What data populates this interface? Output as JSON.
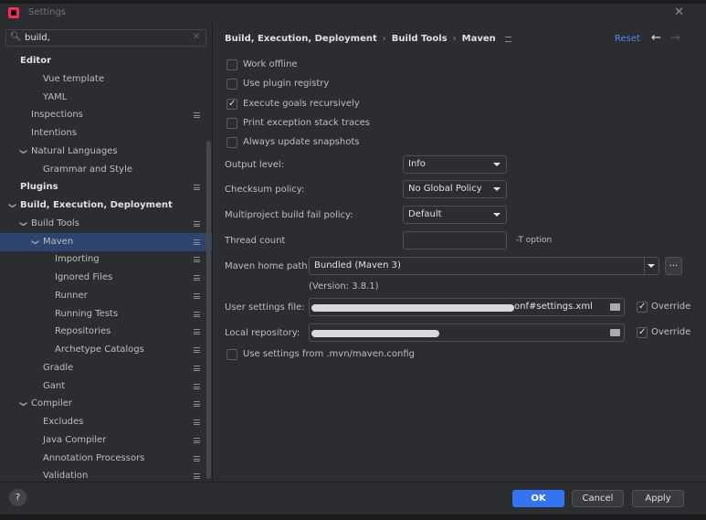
{
  "window": {
    "title": "Settings",
    "close_icon": "close-icon"
  },
  "colors": {
    "accent": "#3574f0",
    "selection": "#2e436e",
    "link": "#548af7",
    "background": "#2b2d30"
  },
  "search": {
    "value": "build,",
    "icon": "search-icon"
  },
  "tree": [
    {
      "label": "Editor",
      "bold": true,
      "level": 0,
      "chevron": "",
      "pg": false
    },
    {
      "label": "Vue template",
      "level": 2,
      "chevron": "",
      "pg": false
    },
    {
      "label": "YAML",
      "level": 2,
      "chevron": "",
      "pg": false
    },
    {
      "label": "Inspections",
      "level": 1,
      "chevron": "",
      "pg": true
    },
    {
      "label": "Intentions",
      "level": 1,
      "chevron": "",
      "pg": false
    },
    {
      "label": "Natural Languages",
      "level": 1,
      "chevron": "v",
      "pg": false
    },
    {
      "label": "Grammar and Style",
      "level": 2,
      "chevron": "",
      "pg": false
    },
    {
      "label": "Plugins",
      "bold": true,
      "level": 0,
      "chevron": "",
      "pg": true
    },
    {
      "label": "Build, Execution, Deployment",
      "bold": true,
      "level": 0,
      "chevron": "v",
      "pg": false
    },
    {
      "label": "Build Tools",
      "level": 1,
      "chevron": "v",
      "pg": true
    },
    {
      "label": "Maven",
      "level": 2,
      "chevron": "v",
      "pg": true,
      "selected": true
    },
    {
      "label": "Importing",
      "level": 3,
      "chevron": "",
      "pg": true
    },
    {
      "label": "Ignored Files",
      "level": 3,
      "chevron": "",
      "pg": true
    },
    {
      "label": "Runner",
      "level": 3,
      "chevron": "",
      "pg": true
    },
    {
      "label": "Running Tests",
      "level": 3,
      "chevron": "",
      "pg": true
    },
    {
      "label": "Repositories",
      "level": 3,
      "chevron": "",
      "pg": true
    },
    {
      "label": "Archetype Catalogs",
      "level": 3,
      "chevron": "",
      "pg": true
    },
    {
      "label": "Gradle",
      "level": 2,
      "chevron": "",
      "pg": true
    },
    {
      "label": "Gant",
      "level": 2,
      "chevron": "",
      "pg": true
    },
    {
      "label": "Compiler",
      "level": 1,
      "chevron": "v",
      "pg": true
    },
    {
      "label": "Excludes",
      "level": 2,
      "chevron": "",
      "pg": true
    },
    {
      "label": "Java Compiler",
      "level": 2,
      "chevron": "",
      "pg": true
    },
    {
      "label": "Annotation Processors",
      "level": 2,
      "chevron": "",
      "pg": true
    },
    {
      "label": "Validation",
      "level": 2,
      "chevron": "",
      "pg": true
    }
  ],
  "breadcrumb": {
    "items": [
      "Build, Execution, Deployment",
      "Build Tools",
      "Maven"
    ],
    "separator": "›"
  },
  "header": {
    "reset_label": "Reset",
    "back_icon": "←",
    "forward_icon": "→"
  },
  "options": [
    {
      "label": "Work offline",
      "checked": false
    },
    {
      "label": "Use plugin registry",
      "checked": false
    },
    {
      "label": "Execute goals recursively",
      "checked": true
    },
    {
      "label": "Print exception stack traces",
      "checked": false
    },
    {
      "label": "Always update snapshots",
      "checked": false
    }
  ],
  "fields": {
    "output_level": {
      "label": "Output level:",
      "value": "Info"
    },
    "checksum_policy": {
      "label": "Checksum policy:",
      "value": "No Global Policy"
    },
    "fail_policy": {
      "label": "Multiproject build fail policy:",
      "value": "Default"
    },
    "thread_count": {
      "label": "Thread count",
      "value": "",
      "hint": "-T option"
    },
    "maven_home": {
      "label": "Maven home path:",
      "value": "Bundled (Maven 3)",
      "browse_label": "...",
      "version": "(Version: 3.8.1)"
    },
    "user_settings": {
      "label": "User settings file:",
      "value_suffix": "onf#settings.xml",
      "override_label": "Override",
      "override_checked": true
    },
    "local_repo": {
      "label": "Local repository:",
      "override_label": "Override",
      "override_checked": true
    },
    "mvn_config": {
      "label": "Use settings from .mvn/maven.config",
      "checked": false
    }
  },
  "footer": {
    "help_label": "?",
    "ok_label": "OK",
    "cancel_label": "Cancel",
    "apply_label": "Apply"
  }
}
